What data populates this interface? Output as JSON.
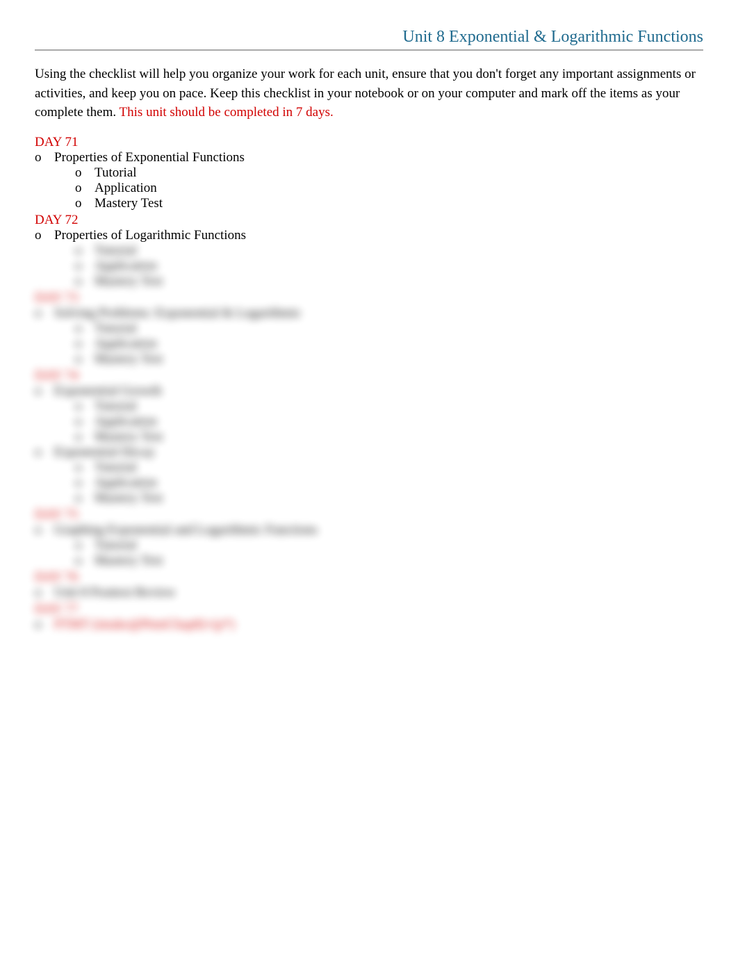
{
  "header": {
    "unit_title": "Unit 8 Exponential & Logarithmic Functions"
  },
  "intro": {
    "text_black": "Using the checklist will help you organize your work for each unit, ensure that you don't forget any important assignments or activities, and keep you on pace. Keep this checklist in your notebook or on your computer and mark off the items as your complete them.  ",
    "text_red": "This unit should be completed in 7 days."
  },
  "days": [
    {
      "label": "DAY 71",
      "blurred": false,
      "topics": [
        {
          "title": "Properties of Exponential Functions",
          "subs": [
            "Tutorial",
            "Application",
            "Mastery Test"
          ]
        }
      ]
    },
    {
      "label": "DAY 72",
      "blurred": false,
      "topics": [
        {
          "title": "Properties of Logarithmic Functions",
          "subs": [
            "Tutorial",
            "Application",
            "Mastery Test"
          ],
          "subs_blurred": true
        }
      ]
    },
    {
      "label": "DAY 73",
      "blurred": true,
      "topics": [
        {
          "title": "Solving Problems: Exponential & Logarithmic",
          "subs": [
            "Tutorial",
            "Application",
            "Mastery Test"
          ]
        }
      ]
    },
    {
      "label": "DAY 74",
      "blurred": true,
      "topics": [
        {
          "title": "Exponential Growth",
          "subs": [
            "Tutorial",
            "Application",
            "Mastery Test"
          ]
        },
        {
          "title": "Exponential Decay",
          "subs": [
            "Tutorial",
            "Application",
            "Mastery Test"
          ]
        }
      ]
    },
    {
      "label": "DAY 75",
      "blurred": true,
      "topics": [
        {
          "title": "Graphing Exponential and Logarithmic Functions",
          "subs": [
            "Tutorial",
            "Mastery Test"
          ]
        }
      ]
    },
    {
      "label": "DAY 76",
      "blurred": true,
      "topics": [
        {
          "title": "Unit 8 Posttest Review",
          "subs": []
        }
      ]
    },
    {
      "label": "DAY 77",
      "blurred": true,
      "topics": [
        {
          "title": "PTMT (intake@PtmtChap8)+(p*)",
          "title_red": true,
          "subs": []
        }
      ]
    }
  ],
  "bullet": "o"
}
